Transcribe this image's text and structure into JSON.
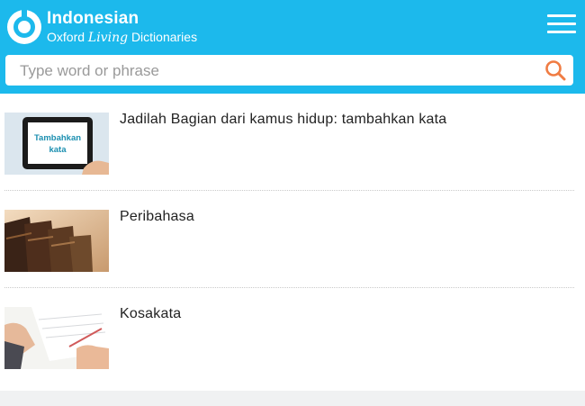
{
  "header": {
    "title": "Indonesian",
    "subtitle_pre": "Oxford",
    "subtitle_italic": "Living",
    "subtitle_post": "Dictionaries",
    "accent_color": "#1cb9ec"
  },
  "search": {
    "placeholder": "Type word or phrase",
    "value": "",
    "icon": "search-icon",
    "icon_color": "#f07c43"
  },
  "menu": {
    "icon": "hamburger-menu-icon"
  },
  "items": [
    {
      "title": "Jadilah Bagian dari kamus hidup: tambahkan kata",
      "thumb_text": [
        "Tambahkan",
        "kata"
      ]
    },
    {
      "title": "Peribahasa"
    },
    {
      "title": "Kosakata"
    }
  ]
}
